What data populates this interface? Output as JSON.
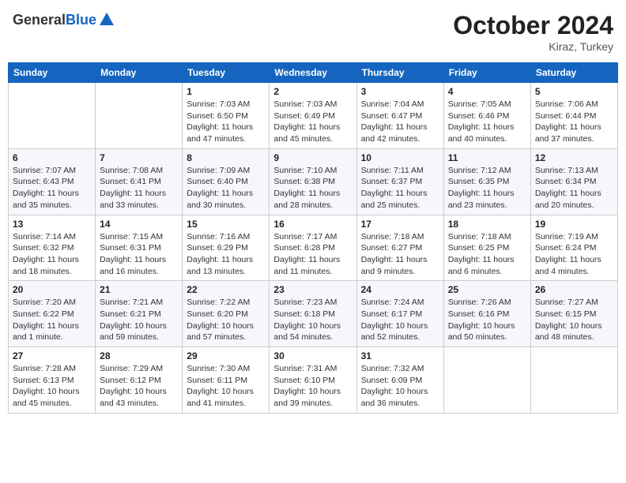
{
  "header": {
    "logo_general": "General",
    "logo_blue": "Blue",
    "month": "October 2024",
    "location": "Kiraz, Turkey"
  },
  "weekdays": [
    "Sunday",
    "Monday",
    "Tuesday",
    "Wednesday",
    "Thursday",
    "Friday",
    "Saturday"
  ],
  "weeks": [
    [
      {
        "day": "",
        "info": ""
      },
      {
        "day": "",
        "info": ""
      },
      {
        "day": "1",
        "info": "Sunrise: 7:03 AM\nSunset: 6:50 PM\nDaylight: 11 hours\nand 47 minutes."
      },
      {
        "day": "2",
        "info": "Sunrise: 7:03 AM\nSunset: 6:49 PM\nDaylight: 11 hours\nand 45 minutes."
      },
      {
        "day": "3",
        "info": "Sunrise: 7:04 AM\nSunset: 6:47 PM\nDaylight: 11 hours\nand 42 minutes."
      },
      {
        "day": "4",
        "info": "Sunrise: 7:05 AM\nSunset: 6:46 PM\nDaylight: 11 hours\nand 40 minutes."
      },
      {
        "day": "5",
        "info": "Sunrise: 7:06 AM\nSunset: 6:44 PM\nDaylight: 11 hours\nand 37 minutes."
      }
    ],
    [
      {
        "day": "6",
        "info": "Sunrise: 7:07 AM\nSunset: 6:43 PM\nDaylight: 11 hours\nand 35 minutes."
      },
      {
        "day": "7",
        "info": "Sunrise: 7:08 AM\nSunset: 6:41 PM\nDaylight: 11 hours\nand 33 minutes."
      },
      {
        "day": "8",
        "info": "Sunrise: 7:09 AM\nSunset: 6:40 PM\nDaylight: 11 hours\nand 30 minutes."
      },
      {
        "day": "9",
        "info": "Sunrise: 7:10 AM\nSunset: 6:38 PM\nDaylight: 11 hours\nand 28 minutes."
      },
      {
        "day": "10",
        "info": "Sunrise: 7:11 AM\nSunset: 6:37 PM\nDaylight: 11 hours\nand 25 minutes."
      },
      {
        "day": "11",
        "info": "Sunrise: 7:12 AM\nSunset: 6:35 PM\nDaylight: 11 hours\nand 23 minutes."
      },
      {
        "day": "12",
        "info": "Sunrise: 7:13 AM\nSunset: 6:34 PM\nDaylight: 11 hours\nand 20 minutes."
      }
    ],
    [
      {
        "day": "13",
        "info": "Sunrise: 7:14 AM\nSunset: 6:32 PM\nDaylight: 11 hours\nand 18 minutes."
      },
      {
        "day": "14",
        "info": "Sunrise: 7:15 AM\nSunset: 6:31 PM\nDaylight: 11 hours\nand 16 minutes."
      },
      {
        "day": "15",
        "info": "Sunrise: 7:16 AM\nSunset: 6:29 PM\nDaylight: 11 hours\nand 13 minutes."
      },
      {
        "day": "16",
        "info": "Sunrise: 7:17 AM\nSunset: 6:28 PM\nDaylight: 11 hours\nand 11 minutes."
      },
      {
        "day": "17",
        "info": "Sunrise: 7:18 AM\nSunset: 6:27 PM\nDaylight: 11 hours\nand 9 minutes."
      },
      {
        "day": "18",
        "info": "Sunrise: 7:18 AM\nSunset: 6:25 PM\nDaylight: 11 hours\nand 6 minutes."
      },
      {
        "day": "19",
        "info": "Sunrise: 7:19 AM\nSunset: 6:24 PM\nDaylight: 11 hours\nand 4 minutes."
      }
    ],
    [
      {
        "day": "20",
        "info": "Sunrise: 7:20 AM\nSunset: 6:22 PM\nDaylight: 11 hours\nand 1 minute."
      },
      {
        "day": "21",
        "info": "Sunrise: 7:21 AM\nSunset: 6:21 PM\nDaylight: 10 hours\nand 59 minutes."
      },
      {
        "day": "22",
        "info": "Sunrise: 7:22 AM\nSunset: 6:20 PM\nDaylight: 10 hours\nand 57 minutes."
      },
      {
        "day": "23",
        "info": "Sunrise: 7:23 AM\nSunset: 6:18 PM\nDaylight: 10 hours\nand 54 minutes."
      },
      {
        "day": "24",
        "info": "Sunrise: 7:24 AM\nSunset: 6:17 PM\nDaylight: 10 hours\nand 52 minutes."
      },
      {
        "day": "25",
        "info": "Sunrise: 7:26 AM\nSunset: 6:16 PM\nDaylight: 10 hours\nand 50 minutes."
      },
      {
        "day": "26",
        "info": "Sunrise: 7:27 AM\nSunset: 6:15 PM\nDaylight: 10 hours\nand 48 minutes."
      }
    ],
    [
      {
        "day": "27",
        "info": "Sunrise: 7:28 AM\nSunset: 6:13 PM\nDaylight: 10 hours\nand 45 minutes."
      },
      {
        "day": "28",
        "info": "Sunrise: 7:29 AM\nSunset: 6:12 PM\nDaylight: 10 hours\nand 43 minutes."
      },
      {
        "day": "29",
        "info": "Sunrise: 7:30 AM\nSunset: 6:11 PM\nDaylight: 10 hours\nand 41 minutes."
      },
      {
        "day": "30",
        "info": "Sunrise: 7:31 AM\nSunset: 6:10 PM\nDaylight: 10 hours\nand 39 minutes."
      },
      {
        "day": "31",
        "info": "Sunrise: 7:32 AM\nSunset: 6:09 PM\nDaylight: 10 hours\nand 36 minutes."
      },
      {
        "day": "",
        "info": ""
      },
      {
        "day": "",
        "info": ""
      }
    ]
  ]
}
